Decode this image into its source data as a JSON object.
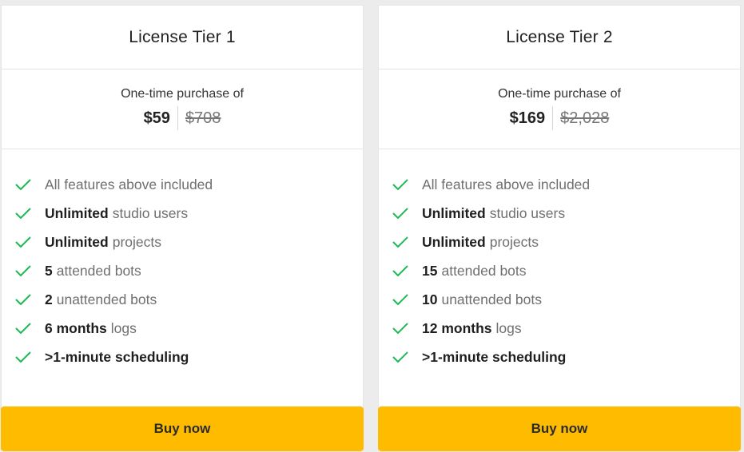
{
  "accent_color": "#ffbb00",
  "check_color": "#1db954",
  "tiers": [
    {
      "title": "License Tier 1",
      "caption": "One-time purchase of",
      "price": "$59",
      "old_price": "$708",
      "features": [
        {
          "bold": "",
          "text": "All features above included"
        },
        {
          "bold": "Unlimited",
          "text": "studio users"
        },
        {
          "bold": "Unlimited",
          "text": "projects"
        },
        {
          "bold": "5",
          "text": "attended bots"
        },
        {
          "bold": "2",
          "text": "unattended bots"
        },
        {
          "bold": "6 months",
          "text": "logs"
        },
        {
          "bold": ">1-minute scheduling",
          "text": ""
        }
      ],
      "button": "Buy now"
    },
    {
      "title": "License Tier 2",
      "caption": "One-time purchase of",
      "price": "$169",
      "old_price": "$2,028",
      "features": [
        {
          "bold": "",
          "text": "All features above included"
        },
        {
          "bold": "Unlimited",
          "text": "studio users"
        },
        {
          "bold": "Unlimited",
          "text": "projects"
        },
        {
          "bold": "15",
          "text": "attended bots"
        },
        {
          "bold": "10",
          "text": "unattended bots"
        },
        {
          "bold": "12 months",
          "text": "logs"
        },
        {
          "bold": ">1-minute scheduling",
          "text": ""
        }
      ],
      "button": "Buy now"
    }
  ]
}
